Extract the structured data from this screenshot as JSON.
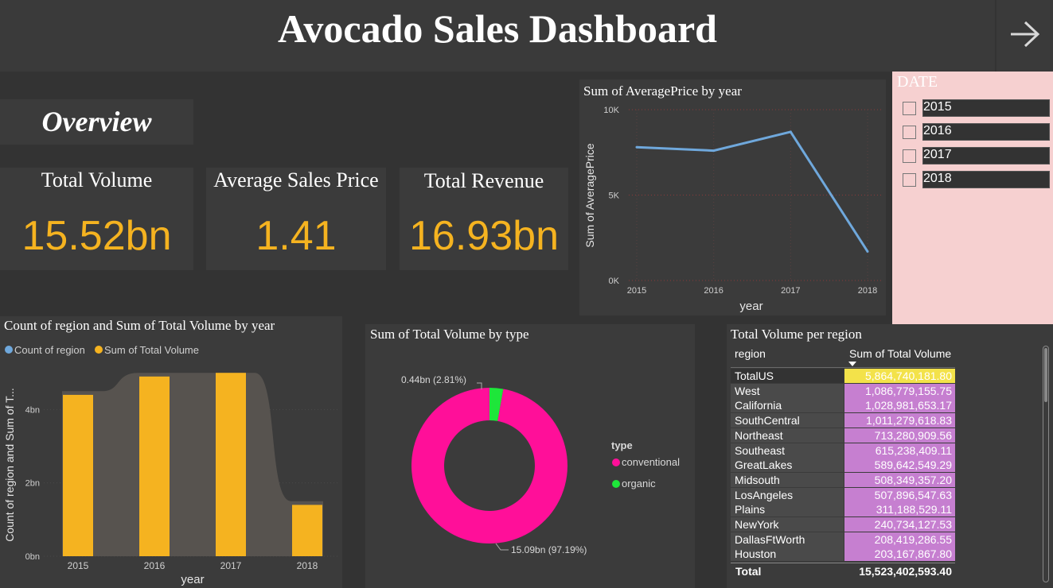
{
  "header": {
    "title": "Avocado Sales Dashboard",
    "nav_icon": "arrow-right-icon"
  },
  "overview": {
    "label": "Overview"
  },
  "kpis": [
    {
      "title": "Total Volume",
      "value": "15.52bn"
    },
    {
      "title": "Average Sales Price",
      "value": "1.41"
    },
    {
      "title": "Total Revenue",
      "value": "16.93bn"
    }
  ],
  "slicer": {
    "title": "DATE",
    "options": [
      "2015",
      "2016",
      "2017",
      "2018"
    ]
  },
  "colors": {
    "accent": "#f5b320",
    "line": "#6fa8dc",
    "conventional": "#ff0f99",
    "organic": "#1ee63a",
    "area": "#57534f",
    "highlight": "#f3e24a",
    "bar_fill": "#c67fd0",
    "slicer_bg": "#f6d0d0"
  },
  "chart_data": [
    {
      "type": "line",
      "title": "Sum of AveragePrice by year",
      "xlabel": "year",
      "ylabel": "Sum of AveragePrice",
      "x": [
        "2015",
        "2016",
        "2017",
        "2018"
      ],
      "values": [
        7800,
        7600,
        8700,
        1700
      ],
      "ylim": [
        0,
        10000
      ],
      "yticks": [
        "0K",
        "5K",
        "10K"
      ],
      "grid": true
    },
    {
      "type": "bar",
      "title": "Count of region and Sum of Total Volume by year",
      "xlabel": "year",
      "ylabel": "Count of region and Sum of T...",
      "legend": [
        "Count of region",
        "Sum of Total Volume"
      ],
      "legend_placement": "top-left",
      "categories": [
        "2015",
        "2016",
        "2017",
        "2018"
      ],
      "series": [
        {
          "name": "Sum of Total Volume",
          "values": [
            4.4,
            4.9,
            5.0,
            1.4
          ]
        },
        {
          "name": "Count of region",
          "values": [
            4.5,
            5.0,
            5.0,
            1.5
          ]
        }
      ],
      "yticks": [
        "0bn",
        "2bn",
        "4bn"
      ],
      "ylim": [
        0,
        5.2
      ]
    },
    {
      "type": "pie",
      "title": "Sum of Total Volume by type",
      "legend_title": "type",
      "slices": [
        {
          "name": "conventional",
          "value": 15.09,
          "label": "15.09bn (97.19%)"
        },
        {
          "name": "organic",
          "value": 0.44,
          "label": "0.44bn (2.81%)"
        }
      ]
    },
    {
      "type": "table",
      "title": "Total Volume per region",
      "columns": [
        "region",
        "Sum of Total Volume"
      ],
      "rows": [
        [
          "TotalUS",
          "5,864,740,181.80"
        ],
        [
          "West",
          "1,086,779,155.75"
        ],
        [
          "California",
          "1,028,981,653.17"
        ],
        [
          "SouthCentral",
          "1,011,279,618.83"
        ],
        [
          "Northeast",
          "713,280,909.56"
        ],
        [
          "Southeast",
          "615,238,409.11"
        ],
        [
          "GreatLakes",
          "589,642,549.29"
        ],
        [
          "Midsouth",
          "508,349,357.20"
        ],
        [
          "LosAngeles",
          "507,896,547.63"
        ],
        [
          "Plains",
          "311,188,529.11"
        ],
        [
          "NewYork",
          "240,734,127.53"
        ],
        [
          "DallasFtWorth",
          "208,419,286.55"
        ],
        [
          "Houston",
          "203,167,867.80"
        ]
      ],
      "values_numeric": [
        5864740181.8,
        1086779155.75,
        1028981653.17,
        1011279618.83,
        713280909.56,
        615238409.11,
        589642549.29,
        508349357.2,
        507896547.63,
        311188529.11,
        240734127.53,
        208419286.55,
        203167867.8
      ],
      "total_label": "Total",
      "total_value": "15,523,402,593.40"
    }
  ]
}
